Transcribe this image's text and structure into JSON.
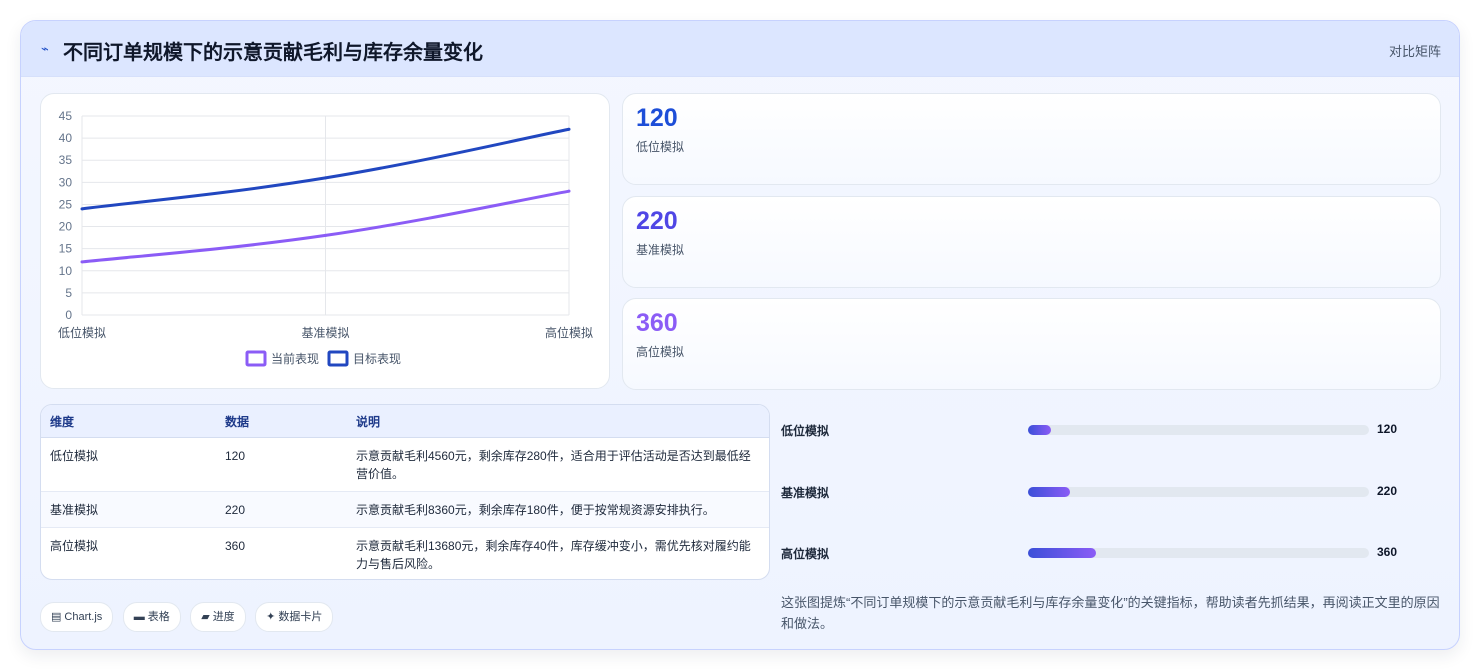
{
  "header": {
    "icon": "chart-line-icon",
    "title": "不同订单规模下的示意贡献毛利与库存余量变化",
    "tag": "对比矩阵"
  },
  "colors": {
    "current": "#8b5cf6",
    "target": "#2147c0",
    "kpi1": "#1d4ed8",
    "kpi2": "#4f46e5",
    "kpi3": "#8b5cf6"
  },
  "chart_data": {
    "type": "line",
    "categories": [
      "低位模拟",
      "基准模拟",
      "高位模拟"
    ],
    "series": [
      {
        "name": "当前表现",
        "values": [
          12,
          18,
          28
        ],
        "color": "#8b5cf6"
      },
      {
        "name": "目标表现",
        "values": [
          24,
          31,
          42
        ],
        "color": "#2147c0"
      }
    ],
    "ylim": [
      0,
      45
    ],
    "yticks": [
      0,
      5,
      10,
      15,
      20,
      25,
      30,
      35,
      40,
      45
    ],
    "grid": true,
    "legend": "bottom"
  },
  "kpis": [
    {
      "value": "120",
      "label": "低位模拟"
    },
    {
      "value": "220",
      "label": "基准模拟"
    },
    {
      "value": "360",
      "label": "高位模拟"
    }
  ],
  "table": {
    "headers": [
      "维度",
      "数据",
      "说明"
    ],
    "rows": [
      [
        "低位模拟",
        "120",
        "示意贡献毛利4560元，剩余库存280件，适合用于评估活动是否达到最低经营价值。"
      ],
      [
        "基准模拟",
        "220",
        "示意贡献毛利8360元，剩余库存180件，便于按常规资源安排执行。"
      ],
      [
        "高位模拟",
        "360",
        "示意贡献毛利13680元，剩余库存40件，库存缓冲变小，需优先核对履约能力与售后风险。"
      ]
    ]
  },
  "progress": {
    "max": 1800,
    "items": [
      {
        "label": "低位模拟",
        "value": 120
      },
      {
        "label": "基准模拟",
        "value": 220
      },
      {
        "label": "高位模拟",
        "value": 360
      }
    ]
  },
  "chips": [
    {
      "icon": "chart-icon",
      "glyph": "▤",
      "label": "Chart.js"
    },
    {
      "icon": "table-icon",
      "glyph": "▬",
      "label": "表格"
    },
    {
      "icon": "progress-icon",
      "glyph": "▰",
      "label": "进度"
    },
    {
      "icon": "sparkle-icon",
      "glyph": "✦",
      "label": "数据卡片"
    }
  ],
  "note": "这张图提炼“不同订单规模下的示意贡献毛利与库存余量变化”的关键指标，帮助读者先抓结果，再阅读正文里的原因和做法。"
}
